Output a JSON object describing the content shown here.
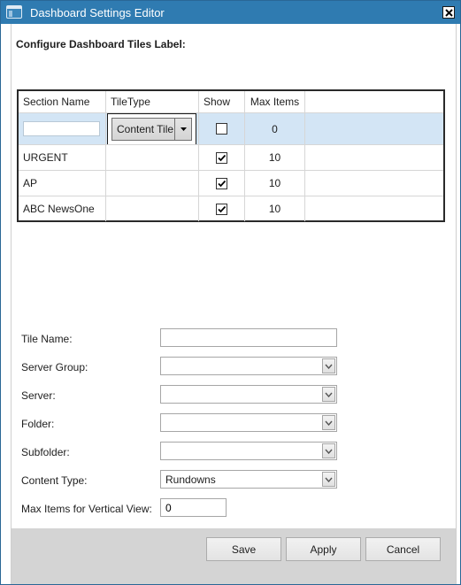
{
  "window": {
    "title": "Dashboard Settings Editor",
    "icon": "window-app-icon",
    "accent_color": "#2f7bb1"
  },
  "section": {
    "label": "Configure Dashboard Tiles Label:"
  },
  "grid": {
    "columns": [
      "Section Name",
      "TileType",
      "Show",
      "Max Items"
    ],
    "rows": [
      {
        "section_name": "",
        "tile_type": "Content Tile",
        "show": false,
        "max_items": "0",
        "selected": true
      },
      {
        "section_name": "URGENT",
        "tile_type": "",
        "show": true,
        "max_items": "10",
        "selected": false
      },
      {
        "section_name": "AP",
        "tile_type": "",
        "show": true,
        "max_items": "10",
        "selected": false
      },
      {
        "section_name": "ABC NewsOne",
        "tile_type": "",
        "show": true,
        "max_items": "10",
        "selected": false
      }
    ],
    "selected_row_color": "#d3e5f5"
  },
  "form": {
    "tile_name": {
      "label": "Tile Name:",
      "value": ""
    },
    "server_group": {
      "label": "Server Group:",
      "value": ""
    },
    "server": {
      "label": "Server:",
      "value": ""
    },
    "folder": {
      "label": "Folder:",
      "value": ""
    },
    "subfolder": {
      "label": "Subfolder:",
      "value": ""
    },
    "content_type": {
      "label": "Content Type:",
      "value": "Rundowns"
    },
    "max_items_vertical": {
      "label": "Max Items for Vertical View:",
      "value": "0"
    }
  },
  "buttons": {
    "save": "Save",
    "apply": "Apply",
    "cancel": "Cancel"
  }
}
